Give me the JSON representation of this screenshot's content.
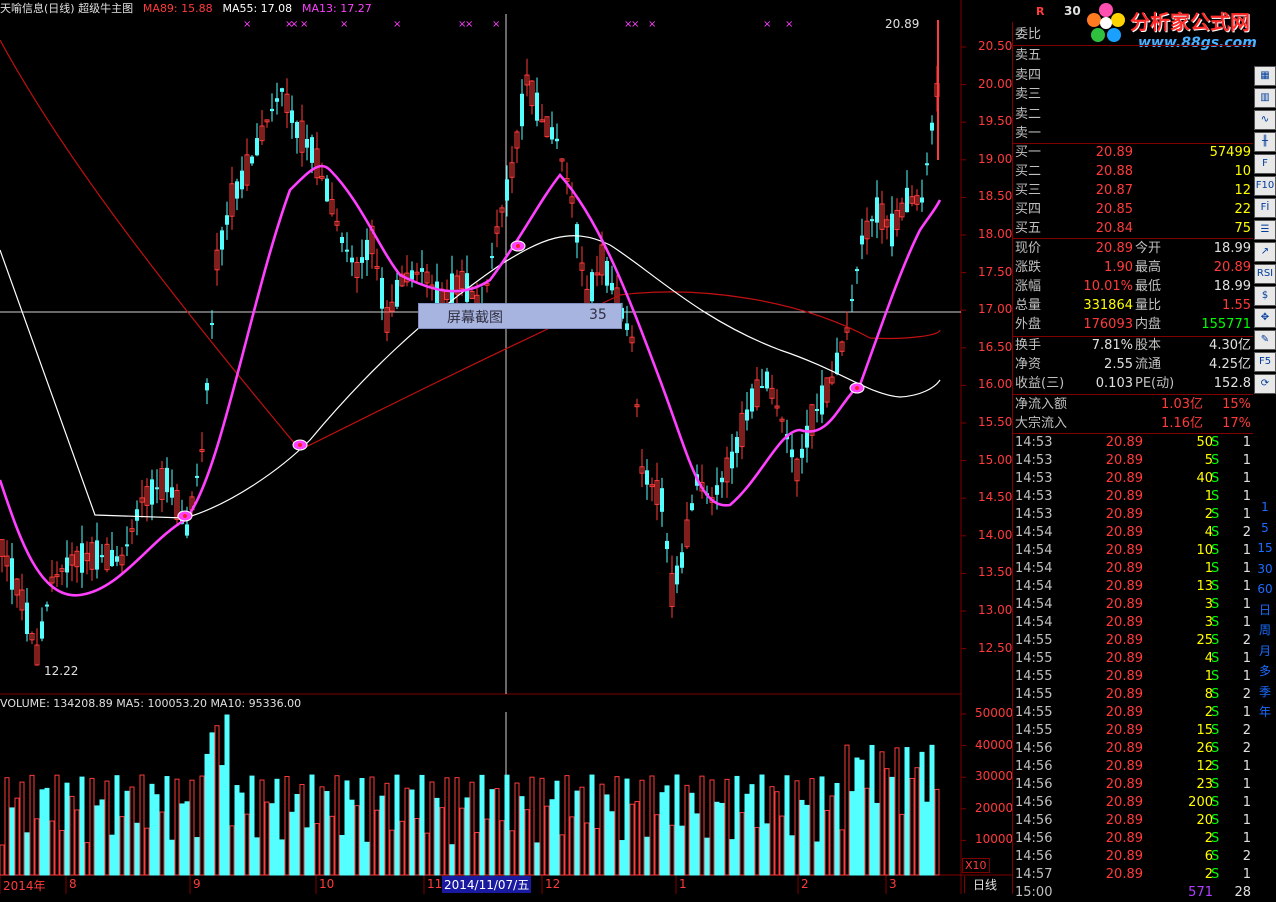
{
  "header": {
    "title": "天喻信息(日线) 超级牛主图",
    "ma89": "MA89: 15.88",
    "ma55": "MA55: 17.08",
    "ma13": "MA13: 17.27"
  },
  "price_axis": [
    "20.50",
    "20.00",
    "19.50",
    "19.00",
    "18.50",
    "18.00",
    "17.50",
    "17.00",
    "16.50",
    "16.00",
    "15.50",
    "15.00",
    "14.50",
    "14.00",
    "13.50",
    "13.00",
    "12.50"
  ],
  "annotations": {
    "high_label": "20.89",
    "low_label": "12.22",
    "r_marker": "R",
    "code_partial": "30"
  },
  "popup": {
    "title": "屏幕截图",
    "number": "35"
  },
  "volume": {
    "header": "VOLUME: 134208.89  MA5: 100053.20  MA10: 95336.00",
    "axis": [
      "50000",
      "40000",
      "30000",
      "20000",
      "10000"
    ],
    "unit": "X10"
  },
  "x_axis": {
    "labels": [
      "2014年",
      "8",
      "9",
      "10",
      "11",
      "12",
      "1",
      "2",
      "3"
    ],
    "cursor_date": "2014/11/07/五",
    "period": "日线"
  },
  "logo": {
    "name": "分析家公式网",
    "url": "www.88gs.com"
  },
  "panel": {
    "weibi": "委比",
    "sell": [
      "卖五",
      "卖四",
      "卖三",
      "卖二",
      "卖一"
    ],
    "buy": [
      {
        "label": "买一",
        "price": "20.89",
        "vol": "57499"
      },
      {
        "label": "买二",
        "price": "20.88",
        "vol": "10"
      },
      {
        "label": "买三",
        "price": "20.87",
        "vol": "12"
      },
      {
        "label": "买四",
        "price": "20.85",
        "vol": "22"
      },
      {
        "label": "买五",
        "price": "20.84",
        "vol": "75"
      }
    ],
    "stats": [
      {
        "l1": "现价",
        "v1": "20.89",
        "l2": "今开",
        "v2": "18.99"
      },
      {
        "l1": "涨跌",
        "v1": "1.90",
        "l2": "最高",
        "v2": "20.89"
      },
      {
        "l1": "涨幅",
        "v1": "10.01%",
        "l2": "最低",
        "v2": "18.99"
      },
      {
        "l1": "总量",
        "v1": "331864",
        "l2": "量比",
        "v2": "1.55"
      },
      {
        "l1": "外盘",
        "v1": "176093",
        "l2": "内盘",
        "v2": "155771"
      }
    ],
    "stats2": [
      {
        "l1": "换手",
        "v1": "7.81%",
        "l2": "股本",
        "v2": "4.30亿"
      },
      {
        "l1": "净资",
        "v1": "2.55",
        "l2": "流通",
        "v2": "4.25亿"
      },
      {
        "l1": "收益(三)",
        "v1": "0.103",
        "l2": "PE(动)",
        "v2": "152.8"
      }
    ],
    "flows": [
      {
        "label": "净流入额",
        "value": "1.03亿",
        "pct": "15%"
      },
      {
        "label": "大宗流入",
        "value": "1.16亿",
        "pct": "17%"
      }
    ],
    "ticks": [
      {
        "t": "14:53",
        "p": "20.89",
        "v": "50",
        "s": "S",
        "n": "1"
      },
      {
        "t": "14:53",
        "p": "20.89",
        "v": "5",
        "s": "S",
        "n": "1"
      },
      {
        "t": "14:53",
        "p": "20.89",
        "v": "40",
        "s": "S",
        "n": "1"
      },
      {
        "t": "14:53",
        "p": "20.89",
        "v": "1",
        "s": "S",
        "n": "1"
      },
      {
        "t": "14:53",
        "p": "20.89",
        "v": "2",
        "s": "S",
        "n": "1"
      },
      {
        "t": "14:54",
        "p": "20.89",
        "v": "4",
        "s": "S",
        "n": "2"
      },
      {
        "t": "14:54",
        "p": "20.89",
        "v": "10",
        "s": "S",
        "n": "1"
      },
      {
        "t": "14:54",
        "p": "20.89",
        "v": "1",
        "s": "S",
        "n": "1"
      },
      {
        "t": "14:54",
        "p": "20.89",
        "v": "13",
        "s": "S",
        "n": "1"
      },
      {
        "t": "14:54",
        "p": "20.89",
        "v": "3",
        "s": "S",
        "n": "1"
      },
      {
        "t": "14:54",
        "p": "20.89",
        "v": "3",
        "s": "S",
        "n": "1"
      },
      {
        "t": "14:55",
        "p": "20.89",
        "v": "25",
        "s": "S",
        "n": "2"
      },
      {
        "t": "14:55",
        "p": "20.89",
        "v": "4",
        "s": "S",
        "n": "1"
      },
      {
        "t": "14:55",
        "p": "20.89",
        "v": "1",
        "s": "S",
        "n": "1"
      },
      {
        "t": "14:55",
        "p": "20.89",
        "v": "8",
        "s": "S",
        "n": "2"
      },
      {
        "t": "14:55",
        "p": "20.89",
        "v": "2",
        "s": "S",
        "n": "1"
      },
      {
        "t": "14:55",
        "p": "20.89",
        "v": "15",
        "s": "S",
        "n": "2"
      },
      {
        "t": "14:56",
        "p": "20.89",
        "v": "26",
        "s": "S",
        "n": "2"
      },
      {
        "t": "14:56",
        "p": "20.89",
        "v": "12",
        "s": "S",
        "n": "1"
      },
      {
        "t": "14:56",
        "p": "20.89",
        "v": "23",
        "s": "S",
        "n": "1"
      },
      {
        "t": "14:56",
        "p": "20.89",
        "v": "200",
        "s": "S",
        "n": "1"
      },
      {
        "t": "14:56",
        "p": "20.89",
        "v": "20",
        "s": "S",
        "n": "1"
      },
      {
        "t": "14:56",
        "p": "20.89",
        "v": "2",
        "s": "S",
        "n": "1"
      },
      {
        "t": "14:56",
        "p": "20.89",
        "v": "6",
        "s": "S",
        "n": "2"
      },
      {
        "t": "14:57",
        "p": "20.89",
        "v": "2",
        "s": "S",
        "n": "1"
      }
    ],
    "last_row_v": "571",
    "last_row_n": "28"
  },
  "toolbar": [
    "1",
    "5",
    "15",
    "30",
    "60",
    "日",
    "周",
    "月",
    "多",
    "季",
    "年"
  ],
  "colors": {
    "up": "#ff3b3b",
    "down": "#54ffff",
    "ma13": "#ff40ff",
    "ma55": "#ffffff",
    "ma89": "#c01010",
    "grid": "#800000",
    "highlight": "#ffff00"
  }
}
